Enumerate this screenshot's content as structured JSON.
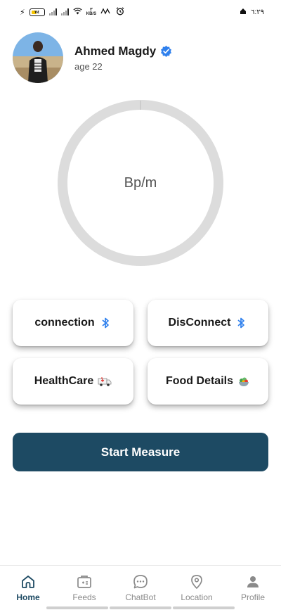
{
  "status_bar": {
    "battery_level": "٧٤",
    "net_speed_value": "٣",
    "net_speed_unit": "KB/S",
    "time": "٦:٢٩"
  },
  "profile": {
    "name": "Ahmed Magdy",
    "age": "age 22",
    "verified_color": "#2f80ed"
  },
  "heart_rate": {
    "label": "Bp/m"
  },
  "actions": {
    "connection": {
      "label": "connection",
      "icon": "bluetooth-icon"
    },
    "disconnect": {
      "label": "DisConnect",
      "icon": "bluetooth-icon"
    },
    "healthcare": {
      "label": "HealthCare",
      "icon": "ambulance-icon"
    },
    "food_details": {
      "label": "Food Details",
      "icon": "salad-icon"
    }
  },
  "start_button": {
    "label": "Start Measure",
    "color": "#1d4a63"
  },
  "bottom_nav": {
    "items": [
      {
        "label": "Home",
        "icon": "home-icon",
        "active": true
      },
      {
        "label": "Feeds",
        "icon": "medical-card-icon",
        "active": false
      },
      {
        "label": "ChatBot",
        "icon": "chat-bubble-icon",
        "active": false
      },
      {
        "label": "Location",
        "icon": "location-pin-icon",
        "active": false
      },
      {
        "label": "Profile",
        "icon": "person-icon",
        "active": false
      }
    ]
  }
}
